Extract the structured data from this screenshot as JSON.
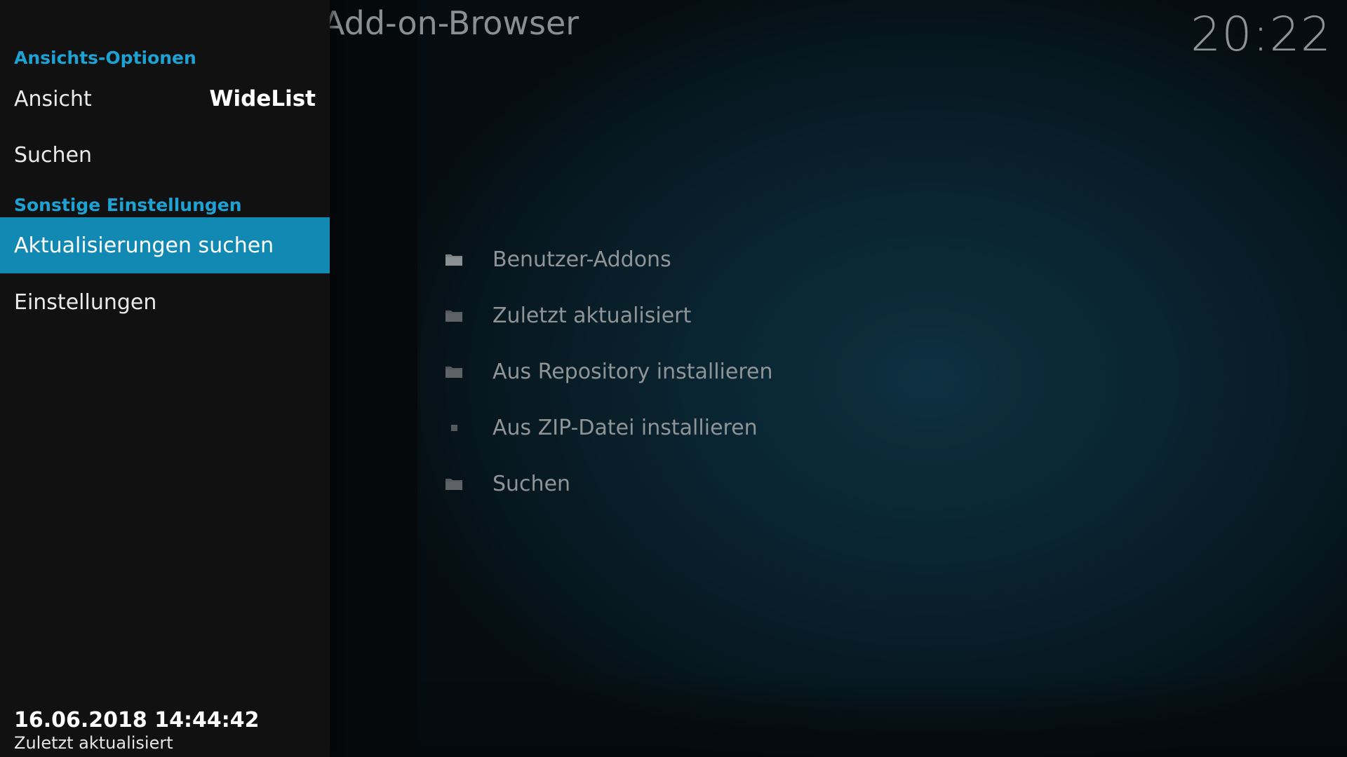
{
  "header": {
    "title": "Add-on-Browser",
    "clock": "20:22"
  },
  "side_menu": {
    "sections": [
      {
        "header": "Ansichts-Optionen",
        "items": [
          {
            "label": "Ansicht",
            "value": "WideList",
            "selected": false
          },
          {
            "label": "Suchen",
            "selected": false
          }
        ]
      },
      {
        "header": "Sonstige Einstellungen",
        "items": [
          {
            "label": "Aktualisierungen suchen",
            "selected": true
          },
          {
            "label": "Einstellungen",
            "selected": false
          }
        ]
      }
    ],
    "footer": {
      "date": "16.06.2018 14:44:42",
      "label": "Zuletzt aktualisiert"
    }
  },
  "file_list": {
    "items": [
      {
        "label": "Benutzer-Addons",
        "icon": "folder-icon"
      },
      {
        "label": "Zuletzt aktualisiert",
        "icon": "folder-icon"
      },
      {
        "label": "Aus Repository installieren",
        "icon": "folder-icon"
      },
      {
        "label": "Aus ZIP-Datei installieren",
        "icon": "square-icon"
      },
      {
        "label": "Suchen",
        "icon": "folder-icon"
      }
    ]
  },
  "colors": {
    "accent": "#1ea2d3",
    "selected_bg": "#1189b3",
    "panel_bg": "#111111",
    "list_text": "#8f9497"
  }
}
